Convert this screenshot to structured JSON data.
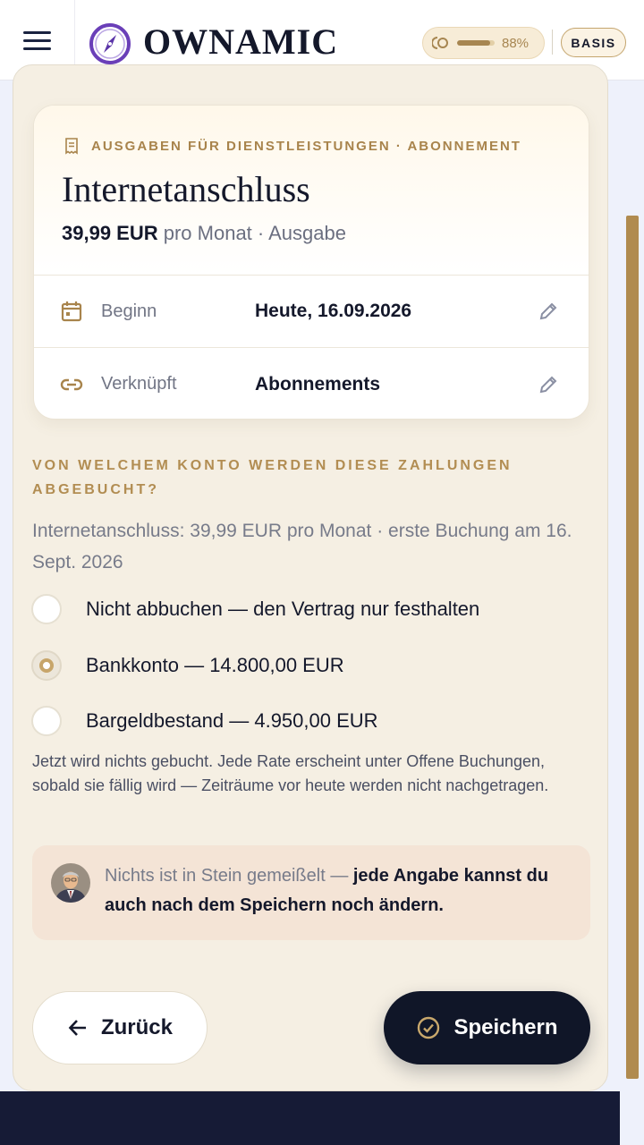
{
  "header": {
    "brand": "OWNAMIC",
    "progress_value": 0.88,
    "progress_label": "88%",
    "plan_badge": "BASIS",
    "icons": {
      "menu": "hamburger-menu-icon",
      "logo": "compass-logo-icon",
      "progress": "ring-progress-icon"
    }
  },
  "card": {
    "category": "AUSGABEN FÜR DIENSTLEISTUNGEN · ABONNEMENT",
    "title": "Internetanschluss",
    "amount": "39,99 EUR",
    "amount_suffix": " pro Monat · Ausgabe",
    "rows": [
      {
        "label": "Beginn",
        "value": "Heute, 16.09.2026",
        "icon": "calendar-icon"
      },
      {
        "label": "Verknüpft",
        "value": "Abonnements",
        "icon": "link-icon"
      }
    ]
  },
  "question": {
    "heading": "VON WELCHEM KONTO WERDEN DIESE ZAHLUNGEN ABGEBUCHT?",
    "subtitle": "Internetanschluss: 39,99 EUR pro Monat · erste Buchung am 16. Sept. 2026",
    "options": [
      {
        "label": "Nicht abbuchen — den Vertrag nur festhalten",
        "selected": false
      },
      {
        "label": "Bankkonto — 14.800,00 EUR",
        "selected": true
      },
      {
        "label": "Bargeldbestand — 4.950,00 EUR",
        "selected": false
      }
    ],
    "hint": "Jetzt wird nichts gebucht. Jede Rate erscheint unter Offene Buchungen, sobald sie fällig wird — Zeiträume vor heute werden nicht nachgetragen."
  },
  "info": {
    "lead": "Nichts ist in Stein gemeißelt — ",
    "emphasis": "jede Angabe kannst du auch nach dem Speichern noch ändern."
  },
  "actions": {
    "back_label": "Zurück",
    "save_label": "Speichern"
  },
  "colors": {
    "accent_gold": "#b08b4f",
    "dark_navy": "#101628",
    "panel_bg": "#f5efe3",
    "info_bg": "#f4e4d6"
  }
}
